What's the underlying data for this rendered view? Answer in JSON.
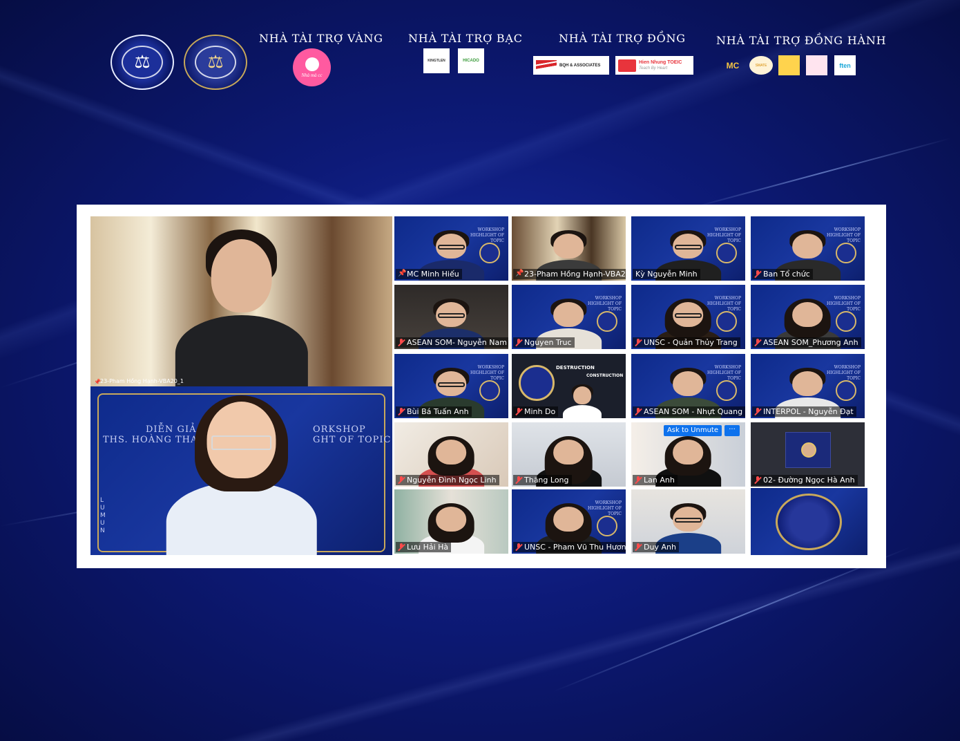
{
  "sponsors": {
    "gold": {
      "title": "NHÀ TÀI TRỢ VÀNG",
      "logo_text": "Nhà mà cc"
    },
    "silver": {
      "title": "NHÀ TÀI TRỢ BẠC",
      "logos": [
        "KINGTLEN",
        "HICADO"
      ]
    },
    "bronze": {
      "title": "NHÀ TÀI TRỢ ĐỒNG",
      "logos": [
        "BQH & ASSOCIATES",
        "Hien Nhung TOEIC",
        "Teach By Heart"
      ]
    },
    "companion": {
      "title": "NHÀ TÀI TRỢ ĐỒNG HÀNH",
      "logos": [
        "MC",
        "SMATE",
        "",
        "",
        "ften"
      ]
    }
  },
  "meeting": {
    "main_tiles": [
      {
        "name": "23-Pham Hồng Hạnh-VBA20_1"
      },
      {
        "slide_speaker": "DIỄN GIẢ:",
        "slide_name": "THS. HOÀNG THANH PHƯƠ",
        "slide_workshop": "ORKSHOP",
        "slide_topic": "GHT OF TOPIC",
        "slide_side": "LUMUN"
      }
    ],
    "grid": [
      {
        "name": "MC Minh Hiếu",
        "icon": "pin"
      },
      {
        "name": "23-Pham Hồng Hạnh-VBA2...",
        "icon": "pin"
      },
      {
        "name": "Kỳ Nguyễn Minh",
        "icon": "none"
      },
      {
        "name": "Ban Tổ chức",
        "icon": "mic-off"
      },
      {
        "name": "ASEAN SOM- Nguyễn Nam",
        "icon": "mic-off"
      },
      {
        "name": "Nguyen Truc",
        "icon": "mic-off"
      },
      {
        "name": "UNSC - Quản Thủy Trang",
        "icon": "mic-off"
      },
      {
        "name": "ASEAN SOM_Phương Anh",
        "icon": "mic-off"
      },
      {
        "name": "Bùi Bá Tuấn Anh",
        "icon": "mic-off"
      },
      {
        "name": "Minh Do",
        "icon": "mic-off",
        "slide_title": "DESTRUCTION",
        "slide_sub": "CONSTRUCTION"
      },
      {
        "name": "ASEAN SOM - Nhựt Quang",
        "icon": "mic-off"
      },
      {
        "name": "INTERPOL - Nguyễn Đạt",
        "icon": "mic-off"
      },
      {
        "name": "Nguyễn Đình Ngọc Linh",
        "icon": "mic-off"
      },
      {
        "name": "Thăng Long",
        "icon": "mic-off"
      },
      {
        "name": "Lan Anh",
        "icon": "mic-off"
      },
      {
        "name": "02- Đường Ngọc Hà Anh",
        "icon": "mic-off"
      },
      {
        "name": "Lưu Hải Hà",
        "icon": "mic-off"
      },
      {
        "name": "UNSC - Pham Vũ Thu Hương",
        "icon": "mic-off"
      },
      {
        "name": "Duy Anh",
        "icon": "mic-off"
      }
    ],
    "tile_slide_text": "WORKSHOP HIGHLIGHT OF TOPIC",
    "ask_to_unmute": "Ask to Unmute",
    "more": "···"
  }
}
